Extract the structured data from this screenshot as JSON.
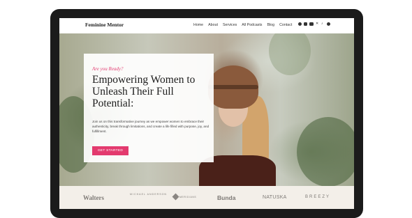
{
  "site": {
    "brand": "Feminine Mentor",
    "nav": [
      "Home",
      "About",
      "Services",
      "All Podcasts",
      "Blog",
      "Contact"
    ],
    "social_icons": [
      "facebook-icon",
      "instagram-icon",
      "youtube-icon",
      "x-icon",
      "tiktok-icon",
      "pinterest-icon"
    ]
  },
  "hero": {
    "eyebrow": "Are you Ready?",
    "heading": "Empowering Women to Unleash Their Full Potential:",
    "body": "Join us on this transformative journey as we empower women to embrace their authenticity, break through limitations, and create a life filled with purpose, joy, and fulfillment.",
    "cta": "GET STARTED"
  },
  "logos": [
    "Walters",
    "MICHAEL ANDERSON",
    "MERIDIANS",
    "Bunda",
    "NATUSKA",
    "BREEZY"
  ],
  "colors": {
    "accent": "#e33a6e",
    "eyebrow": "#e23e73",
    "device": "#1b1b1b",
    "logo_strip": "#f3efe9"
  }
}
